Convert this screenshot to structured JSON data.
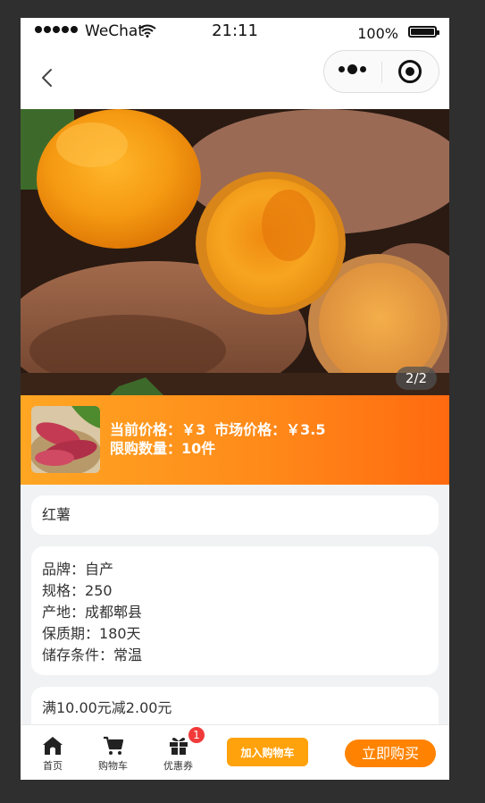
{
  "status_bar": {
    "carrier": "WeChat",
    "time": "21:11",
    "battery": "100%"
  },
  "banner": {
    "indicator": "2/2"
  },
  "product": {
    "current_price_label": "当前价格：",
    "current_price": "￥3",
    "market_price_label": "市场价格：",
    "market_price": "￥3.5",
    "limit_label": "限购数量：",
    "limit_value": "10件",
    "name": "红薯"
  },
  "specs": [
    {
      "label": "品牌：",
      "value": "自产"
    },
    {
      "label": "规格：",
      "value": "250"
    },
    {
      "label": "产地：",
      "value": "成都郫县"
    },
    {
      "label": "保质期：",
      "value": "180天"
    },
    {
      "label": "储存条件：",
      "value": "常温"
    }
  ],
  "coupon": {
    "line1": "满10.00元减2.00元"
  },
  "tabbar": {
    "home": "首页",
    "cart": "购物车",
    "coupons": "优惠券",
    "coupon_badge": "1",
    "add_to_cart": "加入购物车",
    "buy_now": "立即购买"
  },
  "colors": {
    "accent_orange": "#ff8300",
    "cart_button": "#ffa20c",
    "badge_red": "#f23a3a"
  },
  "icons": [
    "back-arrow-icon",
    "more-dots-icon",
    "close-target-icon",
    "home-icon",
    "cart-icon",
    "gift-icon",
    "wifi-icon",
    "battery-icon"
  ]
}
